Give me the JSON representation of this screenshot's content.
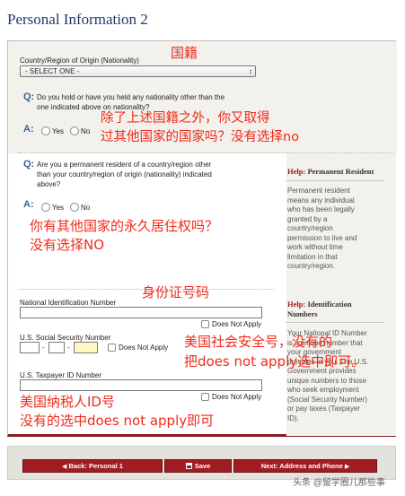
{
  "page_title": "Personal Information 2",
  "nationality": {
    "label": "Country/Region of Origin (Nationality)",
    "selected": "- SELECT ONE -"
  },
  "q1": {
    "q_marker": "Q:",
    "a_marker": "A:",
    "text_line1": "Do you hold or have you held any nationality other than the",
    "text_line2": "one indicated above on nationality?",
    "yes": "Yes",
    "no": "No"
  },
  "q2": {
    "q_marker": "Q:",
    "a_marker": "A:",
    "text_line1": "Are you a permanent resident of a country/region other",
    "text_line2": "than your country/region of origin (nationality) indicated",
    "text_line3": "above?",
    "yes": "Yes",
    "no": "No"
  },
  "help_permanent": {
    "prefix": "Help:",
    "title": "Permanent Resident",
    "lines": [
      "Permanent resident",
      "means any individual",
      "who has been legally",
      "granted by a",
      "country/region",
      "permission to live and",
      "work without time",
      "limitation in that",
      "country/region."
    ]
  },
  "national_id": {
    "label": "National Identification Number",
    "does_not_apply": "Does Not Apply"
  },
  "ssn": {
    "label": "U.S. Social Security Number",
    "separator": "-",
    "does_not_apply": "Does Not Apply"
  },
  "taxpayer": {
    "label": "U.S. Taxpayer ID Number",
    "does_not_apply": "Does Not Apply"
  },
  "help_identification": {
    "prefix": "Help:",
    "title_line1": "Identification",
    "title_line2": "Numbers",
    "lines": [
      "Your National ID Number",
      "is a unique number that",
      "your government",
      "provides to you. The U.S.",
      "Government provides",
      "unique numbers to those",
      "who seek employment",
      "(Social Security Number)",
      "or pay taxes (Taxpayer",
      "ID)."
    ]
  },
  "annotations": {
    "nationality": "国籍",
    "q1_line1": "除了上述国籍之外，你又取得",
    "q1_line2": "过其他国家的国家吗？没有选择no",
    "q2_line1": "你有其他国家的永久居住权吗？",
    "q2_line2": "没有选择NO",
    "id_number": "身份证号码",
    "ssn_line1": "美国社会安全号，没有的",
    "ssn_line2": "把does not apply选中即可。",
    "tax_line1": "美国纳税人ID号",
    "tax_line2": "没有的选中does not apply即可"
  },
  "buttons": {
    "back": "Back: Personal 1",
    "save": "Save",
    "next": "Next: Address and Phone"
  },
  "watermark": "头条 @留学圈儿那些事"
}
